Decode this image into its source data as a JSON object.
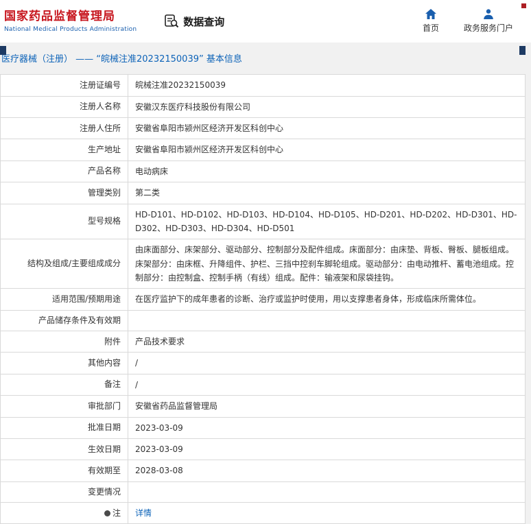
{
  "header": {
    "logo": {
      "title": "国家药品监督管理局",
      "subtitle": "National Medical Products Administration"
    },
    "nav_title": "数据查询",
    "links": [
      {
        "label": "首页",
        "icon": "home-icon"
      },
      {
        "label": "政务服务门户",
        "icon": "person-icon"
      }
    ]
  },
  "page": {
    "title": "医疗器械（注册） —— “皖械注准20232150039” 基本信息"
  },
  "table": {
    "rows": [
      {
        "label": "注册证编号",
        "value": "皖械注准20232150039"
      },
      {
        "label": "注册人名称",
        "value": "安徽汉东医疗科技股份有限公司"
      },
      {
        "label": "注册人住所",
        "value": "安徽省阜阳市颍州区经济开发区科创中心"
      },
      {
        "label": "生产地址",
        "value": "安徽省阜阳市颍州区经济开发区科创中心"
      },
      {
        "label": "产品名称",
        "value": "电动病床"
      },
      {
        "label": "管理类别",
        "value": "第二类"
      },
      {
        "label": "型号规格",
        "value": "HD-D101、HD-D102、HD-D103、HD-D104、HD-D105、HD-D201、HD-D202、HD-D301、HD-D302、HD-D303、HD-D304、HD-D501"
      },
      {
        "label": "结构及组成/主要组成成分",
        "value": "由床面部分、床架部分、驱动部分、控制部分及配件组成。床面部分：由床垫、背板、臀板、腿板组成。床架部分：由床框、升降组件、护栏、三挡中控刹车脚轮组成。驱动部分：由电动推杆、蓄电池组成。控制部分：由控制盒、控制手柄（有线）组成。配件：输液架和尿袋挂钩。"
      },
      {
        "label": "适用范围/预期用途",
        "value": "在医疗监护下的成年患者的诊断、治疗或监护时使用，用以支撑患者身体，形成临床所需体位。"
      },
      {
        "label": "产品储存条件及有效期",
        "value": ""
      },
      {
        "label": "附件",
        "value": "产品技术要求"
      },
      {
        "label": "其他内容",
        "value": "/"
      },
      {
        "label": "备注",
        "value": "/"
      },
      {
        "label": "审批部门",
        "value": "安徽省药品监督管理局"
      },
      {
        "label": "批准日期",
        "value": "2023-03-09"
      },
      {
        "label": "生效日期",
        "value": "2023-03-09"
      },
      {
        "label": "有效期至",
        "value": "2028-03-08"
      },
      {
        "label": "变更情况",
        "value": ""
      },
      {
        "label": "注",
        "value": "详情"
      }
    ]
  },
  "colors": {
    "brand_red": "#c7161e",
    "brand_blue": "#1a5fae",
    "title_blue": "#0d63b8",
    "link_blue": "#0d63b8",
    "border_gray": "#d9d9d9",
    "page_bg": "#f1f1f1"
  }
}
